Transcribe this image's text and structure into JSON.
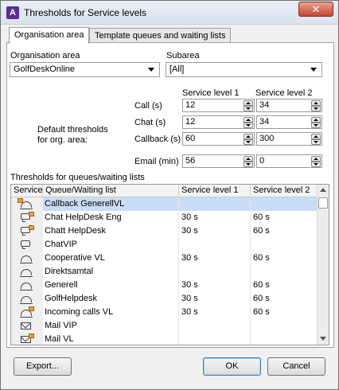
{
  "window": {
    "title": "Thresholds for Service levels",
    "close_label": "✕"
  },
  "tabs": [
    {
      "label": "Organisation area"
    },
    {
      "label": "Template queues and waiting lists"
    }
  ],
  "org_area": {
    "label": "Organisation area",
    "value": "GolfDeskOnline"
  },
  "subarea": {
    "label": "Subarea",
    "value": "[All]"
  },
  "defaults": {
    "caption_line1": "Default thresholds",
    "caption_line2": "for org. area:",
    "col1": "Service level 1",
    "col2": "Service level 2",
    "rows": [
      {
        "label": "Call (s)",
        "sl1": "12",
        "sl2": "34"
      },
      {
        "label": "Chat (s)",
        "sl1": "12",
        "sl2": "34"
      },
      {
        "label": "Callback (s)",
        "sl1": "60",
        "sl2": "300"
      },
      {
        "label": "Email (min)",
        "sl1": "56",
        "sl2": "0"
      }
    ]
  },
  "queues": {
    "section_label": "Thresholds for queues/waiting lists",
    "headers": [
      "Service",
      "Queue/Waiting list",
      "Service level 1",
      "Service level 2"
    ],
    "rows": [
      {
        "icon": "callback-icon",
        "name": "Callback GenerellVL",
        "sl1": "",
        "sl2": ""
      },
      {
        "icon": "chat-icon",
        "name": "Chat  HelpDesk Eng",
        "sl1": "30 s",
        "sl2": "60 s"
      },
      {
        "icon": "chat-icon",
        "name": "Chatt HelpDesk",
        "sl1": "30 s",
        "sl2": "60 s"
      },
      {
        "icon": "chat-icon",
        "name": "ChatVIP",
        "sl1": "",
        "sl2": ""
      },
      {
        "icon": "cooperative-phone-icon",
        "name": "Cooperative VL",
        "sl1": "30 s",
        "sl2": "60 s"
      },
      {
        "icon": "phone-icon",
        "name": "Direktsamtal",
        "sl1": "",
        "sl2": ""
      },
      {
        "icon": "phone-icon",
        "name": "Generell",
        "sl1": "30 s",
        "sl2": "60 s"
      },
      {
        "icon": "phone-icon",
        "name": "GolfHelpdesk",
        "sl1": "30 s",
        "sl2": "60 s"
      },
      {
        "icon": "phone-icon",
        "name": "Incoming calls VL",
        "sl1": "30 s",
        "sl2": "60 s"
      },
      {
        "icon": "mail-icon",
        "name": "Mail VIP",
        "sl1": "",
        "sl2": ""
      },
      {
        "icon": "mail-icon",
        "name": "Mail VL",
        "sl1": "",
        "sl2": ""
      }
    ]
  },
  "buttons": {
    "export": "Export...",
    "ok": "OK",
    "cancel": "Cancel"
  }
}
